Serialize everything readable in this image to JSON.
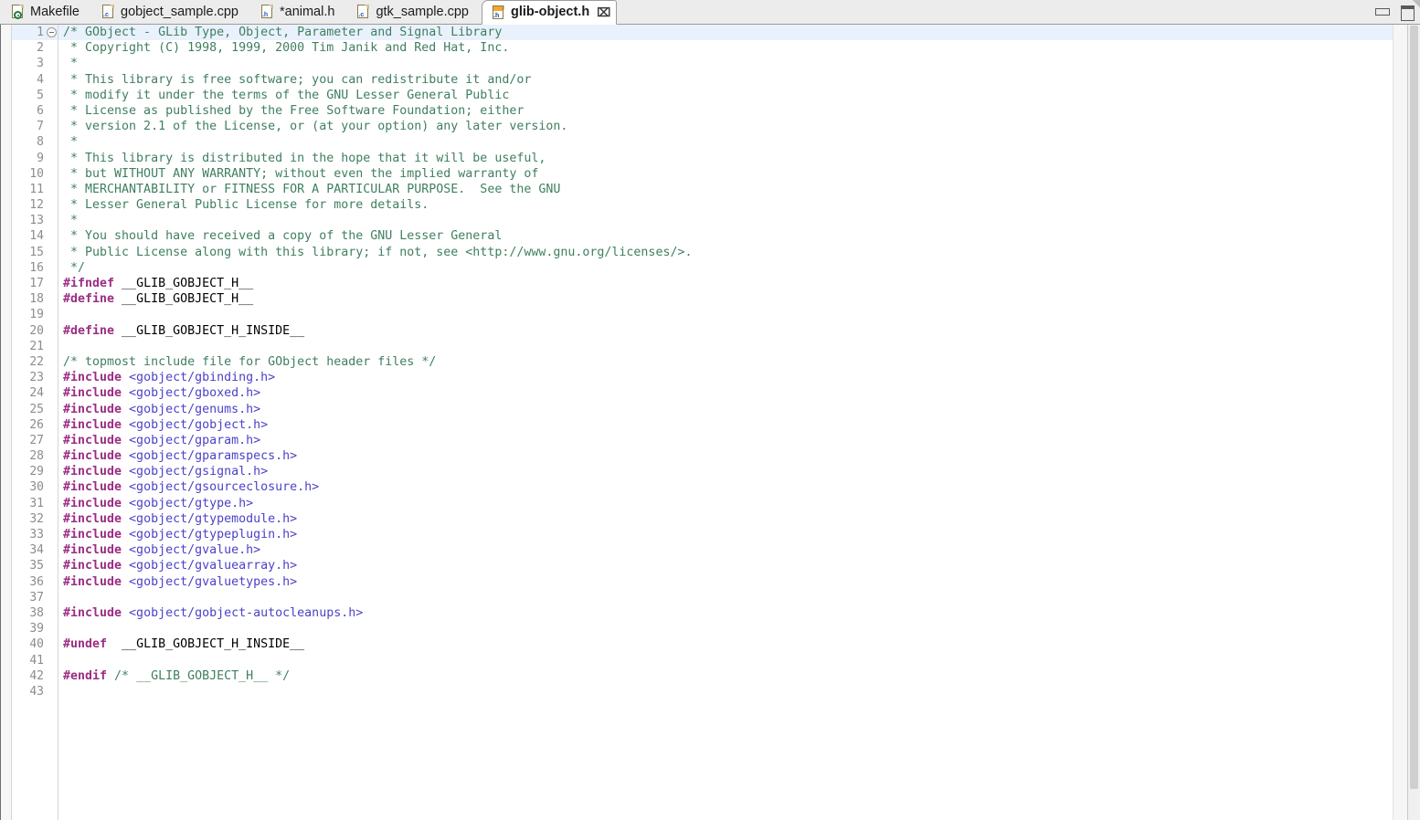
{
  "window": {
    "minimize_label": "Minimize",
    "maximize_label": "Maximize"
  },
  "tabs": [
    {
      "label": "Makefile",
      "icon": "makefile-icon",
      "icon_kind": "mk",
      "ext": "",
      "active": false,
      "dirty": false
    },
    {
      "label": "gobject_sample.cpp",
      "icon": "c-file-icon",
      "icon_kind": "c",
      "ext": ".c",
      "active": false,
      "dirty": false
    },
    {
      "label": "*animal.h",
      "icon": "h-file-icon",
      "icon_kind": "h",
      "ext": ".h",
      "active": false,
      "dirty": true
    },
    {
      "label": "gtk_sample.cpp",
      "icon": "c-file-icon",
      "icon_kind": "c",
      "ext": ".c",
      "active": false,
      "dirty": false
    },
    {
      "label": "glib-object.h",
      "icon": "header-file-icon",
      "icon_kind": "hdr",
      "ext": ".h",
      "active": true,
      "dirty": false
    }
  ],
  "active_tab_close_glyph": "⌧",
  "editor": {
    "filename": "glib-object.h",
    "first_line": 1,
    "last_line": 43,
    "current_line": 1,
    "colors": {
      "comment": "#3f7f5f",
      "preprocessor": "#9b2d84",
      "include_path": "#4b42c8",
      "plain": "#000000",
      "current_line_bg": "#e9f1fc",
      "line_number": "#8c8c8c",
      "tabbar_bg": "#ececec",
      "editor_bg": "#ffffff"
    },
    "fold_marker_line": 1,
    "lines": [
      {
        "n": 1,
        "fold": true,
        "tokens": [
          {
            "t": "comment",
            "s": "/* GObject - GLib Type, Object, Parameter and Signal Library"
          }
        ]
      },
      {
        "n": 2,
        "fold": false,
        "tokens": [
          {
            "t": "comment",
            "s": " * Copyright (C) 1998, 1999, 2000 Tim Janik and Red Hat, Inc."
          }
        ]
      },
      {
        "n": 3,
        "fold": false,
        "tokens": [
          {
            "t": "comment",
            "s": " *"
          }
        ]
      },
      {
        "n": 4,
        "fold": false,
        "tokens": [
          {
            "t": "comment",
            "s": " * This library is free software; you can redistribute it and/or"
          }
        ]
      },
      {
        "n": 5,
        "fold": false,
        "tokens": [
          {
            "t": "comment",
            "s": " * modify it under the terms of the GNU Lesser General Public"
          }
        ]
      },
      {
        "n": 6,
        "fold": false,
        "tokens": [
          {
            "t": "comment",
            "s": " * License as published by the Free Software Foundation; either"
          }
        ]
      },
      {
        "n": 7,
        "fold": false,
        "tokens": [
          {
            "t": "comment",
            "s": " * version 2.1 of the License, or (at your option) any later version."
          }
        ]
      },
      {
        "n": 8,
        "fold": false,
        "tokens": [
          {
            "t": "comment",
            "s": " *"
          }
        ]
      },
      {
        "n": 9,
        "fold": false,
        "tokens": [
          {
            "t": "comment",
            "s": " * This library is distributed in the hope that it will be useful,"
          }
        ]
      },
      {
        "n": 10,
        "fold": false,
        "tokens": [
          {
            "t": "comment",
            "s": " * but WITHOUT ANY WARRANTY; without even the implied warranty of"
          }
        ]
      },
      {
        "n": 11,
        "fold": false,
        "tokens": [
          {
            "t": "comment",
            "s": " * MERCHANTABILITY or FITNESS FOR A PARTICULAR PURPOSE.  See the GNU"
          }
        ]
      },
      {
        "n": 12,
        "fold": false,
        "tokens": [
          {
            "t": "comment",
            "s": " * Lesser General Public License for more details."
          }
        ]
      },
      {
        "n": 13,
        "fold": false,
        "tokens": [
          {
            "t": "comment",
            "s": " *"
          }
        ]
      },
      {
        "n": 14,
        "fold": false,
        "tokens": [
          {
            "t": "comment",
            "s": " * You should have received a copy of the GNU Lesser General"
          }
        ]
      },
      {
        "n": 15,
        "fold": false,
        "tokens": [
          {
            "t": "comment",
            "s": " * Public License along with this library; if not, see <http://www.gnu.org/licenses/>."
          }
        ]
      },
      {
        "n": 16,
        "fold": false,
        "tokens": [
          {
            "t": "comment",
            "s": " */"
          }
        ]
      },
      {
        "n": 17,
        "fold": false,
        "tokens": [
          {
            "t": "pp",
            "s": "#ifndef"
          },
          {
            "t": "plain",
            "s": " __GLIB_GOBJECT_H__"
          }
        ]
      },
      {
        "n": 18,
        "fold": false,
        "tokens": [
          {
            "t": "pp",
            "s": "#define"
          },
          {
            "t": "plain",
            "s": " __GLIB_GOBJECT_H__"
          }
        ]
      },
      {
        "n": 19,
        "fold": false,
        "tokens": []
      },
      {
        "n": 20,
        "fold": false,
        "tokens": [
          {
            "t": "pp",
            "s": "#define"
          },
          {
            "t": "plain",
            "s": " __GLIB_GOBJECT_H_INSIDE__"
          }
        ]
      },
      {
        "n": 21,
        "fold": false,
        "tokens": []
      },
      {
        "n": 22,
        "fold": false,
        "tokens": [
          {
            "t": "comment",
            "s": "/* topmost include file for GObject header files */"
          }
        ]
      },
      {
        "n": 23,
        "fold": false,
        "tokens": [
          {
            "t": "pp",
            "s": "#include"
          },
          {
            "t": "inc",
            "s": " <gobject/gbinding.h>"
          }
        ]
      },
      {
        "n": 24,
        "fold": false,
        "tokens": [
          {
            "t": "pp",
            "s": "#include"
          },
          {
            "t": "inc",
            "s": " <gobject/gboxed.h>"
          }
        ]
      },
      {
        "n": 25,
        "fold": false,
        "tokens": [
          {
            "t": "pp",
            "s": "#include"
          },
          {
            "t": "inc",
            "s": " <gobject/genums.h>"
          }
        ]
      },
      {
        "n": 26,
        "fold": false,
        "tokens": [
          {
            "t": "pp",
            "s": "#include"
          },
          {
            "t": "inc",
            "s": " <gobject/gobject.h>"
          }
        ]
      },
      {
        "n": 27,
        "fold": false,
        "tokens": [
          {
            "t": "pp",
            "s": "#include"
          },
          {
            "t": "inc",
            "s": " <gobject/gparam.h>"
          }
        ]
      },
      {
        "n": 28,
        "fold": false,
        "tokens": [
          {
            "t": "pp",
            "s": "#include"
          },
          {
            "t": "inc",
            "s": " <gobject/gparamspecs.h>"
          }
        ]
      },
      {
        "n": 29,
        "fold": false,
        "tokens": [
          {
            "t": "pp",
            "s": "#include"
          },
          {
            "t": "inc",
            "s": " <gobject/gsignal.h>"
          }
        ]
      },
      {
        "n": 30,
        "fold": false,
        "tokens": [
          {
            "t": "pp",
            "s": "#include"
          },
          {
            "t": "inc",
            "s": " <gobject/gsourceclosure.h>"
          }
        ]
      },
      {
        "n": 31,
        "fold": false,
        "tokens": [
          {
            "t": "pp",
            "s": "#include"
          },
          {
            "t": "inc",
            "s": " <gobject/gtype.h>"
          }
        ]
      },
      {
        "n": 32,
        "fold": false,
        "tokens": [
          {
            "t": "pp",
            "s": "#include"
          },
          {
            "t": "inc",
            "s": " <gobject/gtypemodule.h>"
          }
        ]
      },
      {
        "n": 33,
        "fold": false,
        "tokens": [
          {
            "t": "pp",
            "s": "#include"
          },
          {
            "t": "inc",
            "s": " <gobject/gtypeplugin.h>"
          }
        ]
      },
      {
        "n": 34,
        "fold": false,
        "tokens": [
          {
            "t": "pp",
            "s": "#include"
          },
          {
            "t": "inc",
            "s": " <gobject/gvalue.h>"
          }
        ]
      },
      {
        "n": 35,
        "fold": false,
        "tokens": [
          {
            "t": "pp",
            "s": "#include"
          },
          {
            "t": "inc",
            "s": " <gobject/gvaluearray.h>"
          }
        ]
      },
      {
        "n": 36,
        "fold": false,
        "tokens": [
          {
            "t": "pp",
            "s": "#include"
          },
          {
            "t": "inc",
            "s": " <gobject/gvaluetypes.h>"
          }
        ]
      },
      {
        "n": 37,
        "fold": false,
        "tokens": []
      },
      {
        "n": 38,
        "fold": false,
        "tokens": [
          {
            "t": "pp",
            "s": "#include"
          },
          {
            "t": "inc",
            "s": " <gobject/gobject-autocleanups.h>"
          }
        ]
      },
      {
        "n": 39,
        "fold": false,
        "tokens": []
      },
      {
        "n": 40,
        "fold": false,
        "tokens": [
          {
            "t": "pp",
            "s": "#undef"
          },
          {
            "t": "plain",
            "s": "  __GLIB_GOBJECT_H_INSIDE__"
          }
        ]
      },
      {
        "n": 41,
        "fold": false,
        "tokens": []
      },
      {
        "n": 42,
        "fold": false,
        "tokens": [
          {
            "t": "pp",
            "s": "#endif"
          },
          {
            "t": "comment",
            "s": " /* __GLIB_GOBJECT_H__ */"
          }
        ]
      },
      {
        "n": 43,
        "fold": false,
        "tokens": []
      }
    ]
  }
}
